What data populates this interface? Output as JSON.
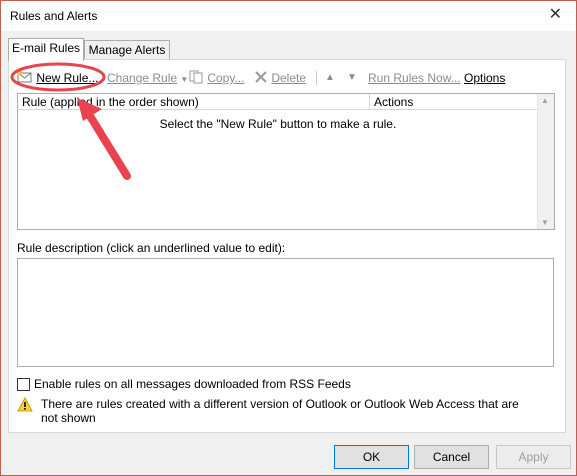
{
  "window": {
    "title": "Rules and Alerts",
    "close_glyph": "✕"
  },
  "tabs": [
    {
      "label": "E-mail Rules",
      "active": true
    },
    {
      "label": "Manage Alerts",
      "active": false
    }
  ],
  "toolbar": {
    "new_rule": "New Rule...",
    "change_rule": "Change Rule",
    "copy": "Copy...",
    "delete": "Delete",
    "run_rules_now": "Run Rules Now...",
    "options": "Options"
  },
  "rules_list": {
    "columns": [
      "Rule (applied in the order shown)",
      "Actions"
    ],
    "empty_message": "Select the \"New Rule\" button to make a rule."
  },
  "description": {
    "label": "Rule description (click an underlined value to edit):"
  },
  "rss_checkbox": {
    "label": "Enable rules on all messages downloaded from RSS Feeds",
    "checked": false
  },
  "warning": {
    "text": "There are rules created with a different version of Outlook or Outlook Web Access that are not shown"
  },
  "buttons": {
    "ok": "OK",
    "cancel": "Cancel",
    "apply": "Apply"
  },
  "colors": {
    "annotation": "#e8434e",
    "default_button_border": "#0078d7",
    "window_border": "#c15e4c"
  }
}
